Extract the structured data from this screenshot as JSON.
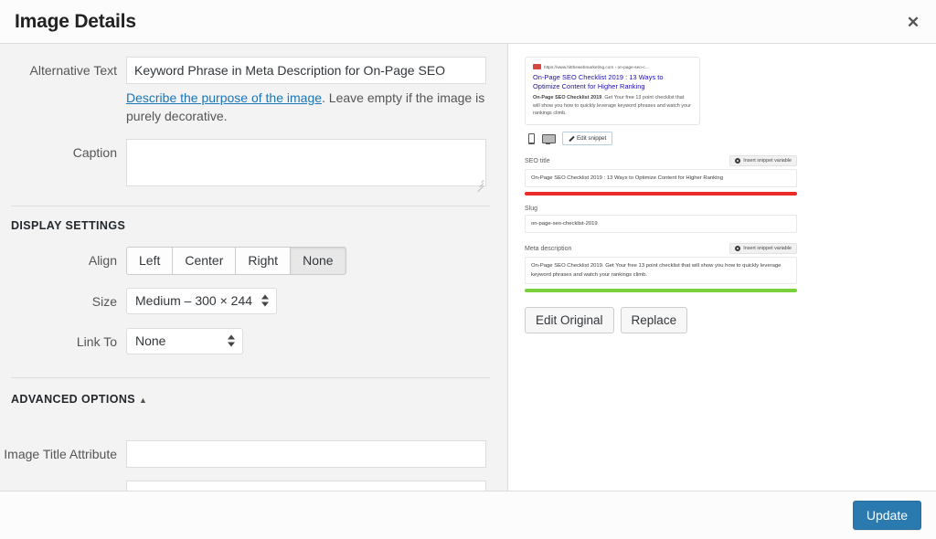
{
  "modal": {
    "title": "Image Details",
    "close_label": "✕"
  },
  "form": {
    "alt_text": {
      "label": "Alternative Text",
      "value": "Keyword Phrase in Meta Description for On-Page SEO",
      "helper_link": "Describe the purpose of the image",
      "helper_rest": ". Leave empty if the image is purely decorative."
    },
    "caption": {
      "label": "Caption",
      "value": "",
      "placeholder": ""
    }
  },
  "display_settings": {
    "heading": "DISPLAY SETTINGS",
    "align": {
      "label": "Align",
      "options": [
        "Left",
        "Center",
        "Right",
        "None"
      ],
      "selected": "None"
    },
    "size": {
      "label": "Size",
      "selected": "Medium – 300 × 244"
    },
    "link_to": {
      "label": "Link To",
      "selected": "None"
    }
  },
  "advanced_options": {
    "heading": "ADVANCED OPTIONS",
    "arrow": "▲",
    "image_title_attribute": {
      "label": "Image Title Attribute",
      "value": ""
    },
    "next_field": {
      "value": ""
    }
  },
  "preview": {
    "snippet": {
      "favicon_color": "#d4483f",
      "url": "https://www.hitthewebmarketing.com › on-page-seo-c…",
      "title": "On-Page SEO Checklist 2019 : 13 Ways to Optimize Content for Higher Ranking",
      "description_bold": "On-Page SEO Checklist 2019",
      "description_rest": ". Get Your free 13 point checklist that will show you how to quickly leverage keyword phrases and watch your rankings climb."
    },
    "device_toggle": {
      "mobile": "mobile-preview",
      "desktop": "desktop-preview"
    },
    "edit_snippet_label": "Edit snippet",
    "seo_title": {
      "label": "SEO title",
      "insert_variable_label": "Insert snippet variable",
      "value": "On-Page SEO Checklist 2019 : 13 Ways to Optimize Content for Higher Ranking",
      "meter_color": "#eb2b28"
    },
    "slug": {
      "label": "Slug",
      "value": "on-page-seo-checklist-2019"
    },
    "meta_description": {
      "label": "Meta description",
      "insert_variable_label": "Insert snippet variable",
      "value": "On-Page SEO Checklist 2019. Get Your free 13 point checklist that will show you how to quickly leverage keyword phrases and watch your rankings climb.",
      "meter_color": "#7ad03a"
    },
    "edit_original_label": "Edit Original",
    "replace_label": "Replace"
  },
  "footer": {
    "update_label": "Update",
    "accent_color": "#2a7ab0"
  }
}
